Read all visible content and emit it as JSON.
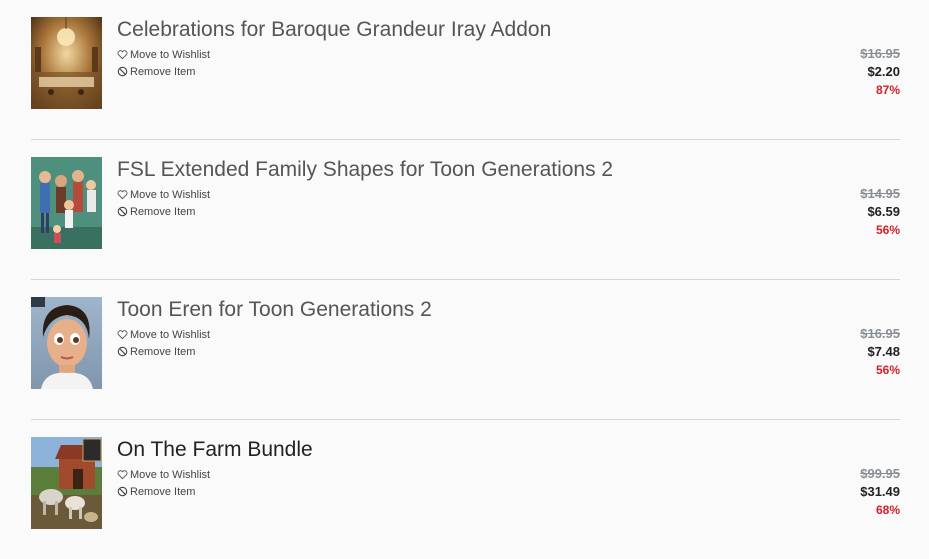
{
  "cart": {
    "items": [
      {
        "title": "Celebrations for Baroque Grandeur Iray Addon",
        "title_color": "#555555",
        "wishlist_label": "Move to Wishlist",
        "remove_label": "Remove Item",
        "old_price": "$16.95",
        "new_price": "$2.20",
        "discount": "87%",
        "thumbnail": "baroque-ballroom"
      },
      {
        "title": "FSL Extended Family Shapes for Toon Generations 2",
        "title_color": "#555555",
        "wishlist_label": "Move to Wishlist",
        "remove_label": "Remove Item",
        "old_price": "$14.95",
        "new_price": "$6.59",
        "discount": "56%",
        "thumbnail": "toon-family"
      },
      {
        "title": "Toon Eren for Toon Generations 2",
        "title_color": "#555555",
        "wishlist_label": "Move to Wishlist",
        "remove_label": "Remove Item",
        "old_price": "$16.95",
        "new_price": "$7.48",
        "discount": "56%",
        "thumbnail": "toon-girl"
      },
      {
        "title": "On The Farm Bundle",
        "title_color": "#222222",
        "wishlist_label": "Move to Wishlist",
        "remove_label": "Remove Item",
        "old_price": "$99.95",
        "new_price": "$31.49",
        "discount": "68%",
        "thumbnail": "farm-animals"
      }
    ]
  },
  "colors": {
    "discount": "#d02027",
    "old_price": "#8a8f96",
    "divider": "#d8d8d8"
  }
}
